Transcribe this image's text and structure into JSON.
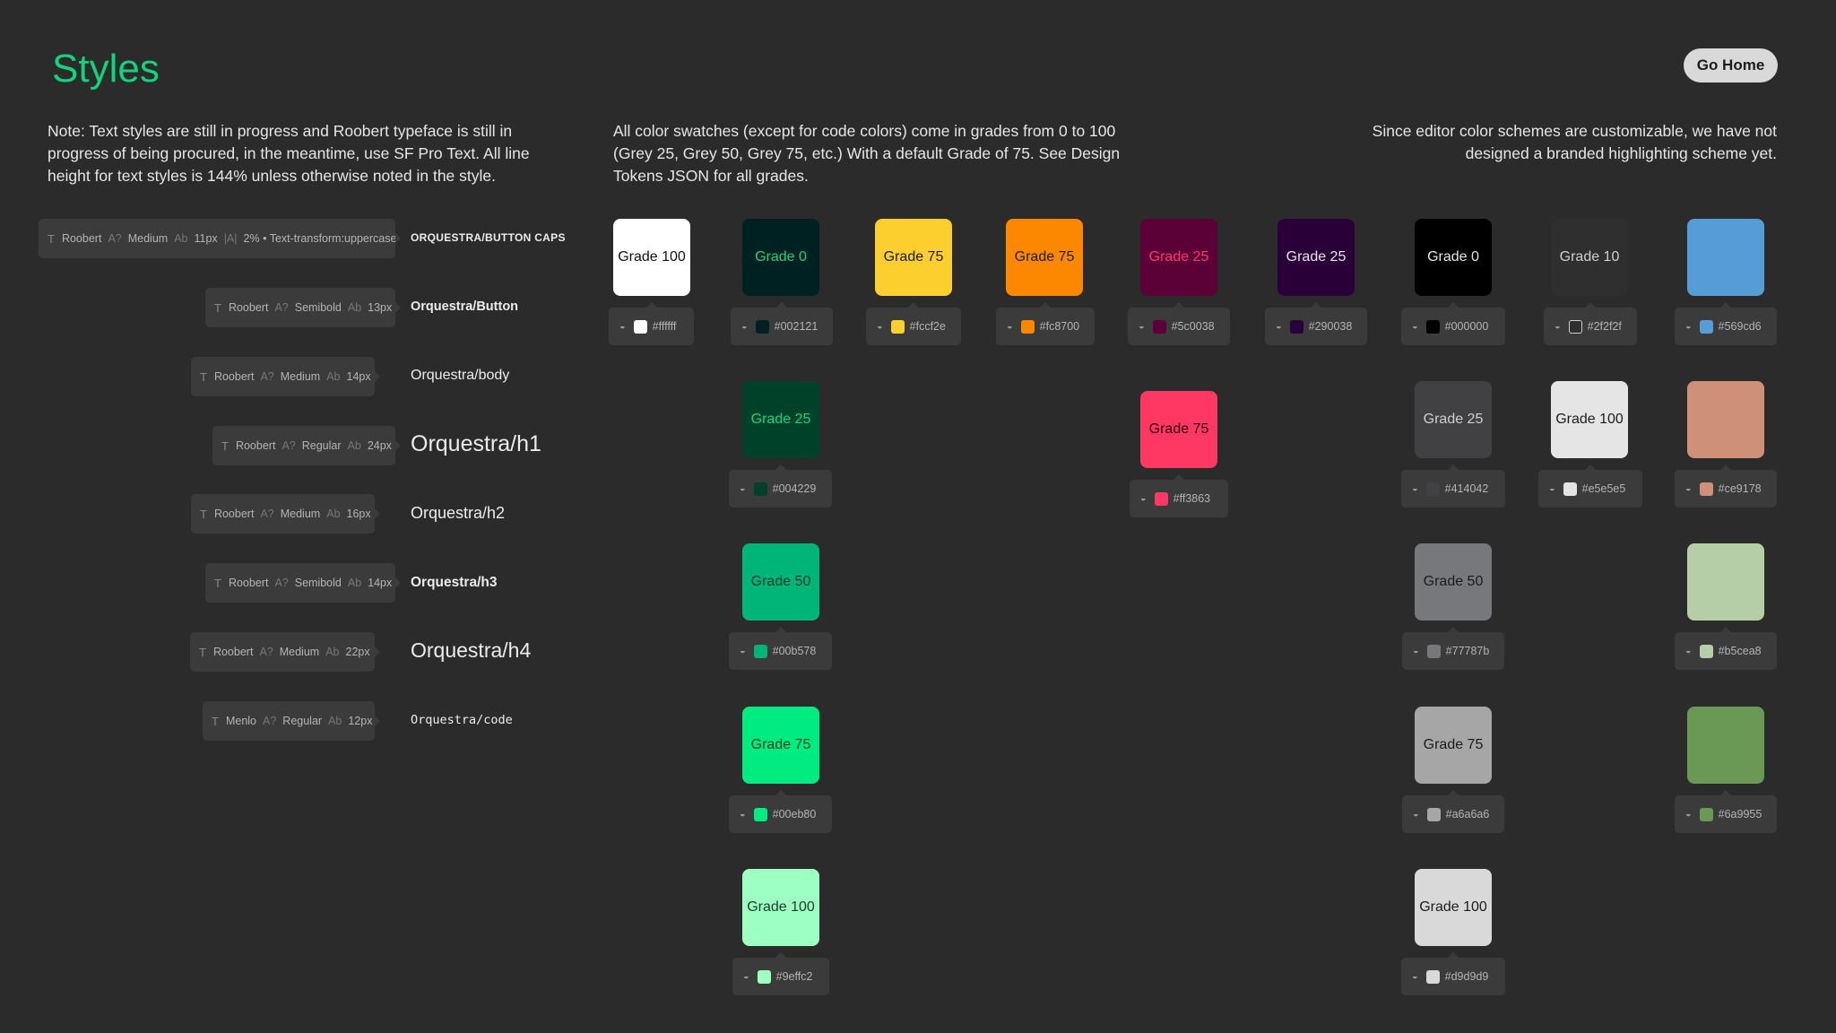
{
  "page": {
    "title": "Styles",
    "go_home_label": "Go Home",
    "note_text": "Note: Text styles are still in progress and Roobert typeface is still in progress of being procured, in the meantime, use SF Pro Text. All line height for text styles is 144% unless otherwise noted in the style.",
    "note_color": "All color swatches (except for code colors) come in grades from 0 to 100 (Grey 25, Grey 50, Grey 75, etc.) With a default Grade of 75. See Design Tokens JSON for all grades.",
    "note_editor": "Since editor color schemes are customizable, we have not designed a branded highlighting scheme yet."
  },
  "text_styles": [
    {
      "font": "Roobert",
      "weight": "Medium",
      "size": "11px",
      "extra_label": "|A|",
      "extra": "2% • Text-transform:uppercase",
      "name": "ORQUESTRA/BUTTON CAPS"
    },
    {
      "font": "Roobert",
      "weight": "Semibold",
      "size": "13px",
      "name": "Orquestra/Button"
    },
    {
      "font": "Roobert",
      "weight": "Medium",
      "size": "14px",
      "name": "Orquestra/body"
    },
    {
      "font": "Roobert",
      "weight": "Regular",
      "size": "24px",
      "name": "Orquestra/h1"
    },
    {
      "font": "Roobert",
      "weight": "Medium",
      "size": "16px",
      "name": "Orquestra/h2"
    },
    {
      "font": "Roobert",
      "weight": "Semibold",
      "size": "14px",
      "name": "Orquestra/h3"
    },
    {
      "font": "Roobert",
      "weight": "Medium",
      "size": "22px",
      "name": "Orquestra/h4"
    },
    {
      "font": "Menlo",
      "weight": "Regular",
      "size": "12px",
      "name": "Orquestra/code"
    }
  ],
  "pill_labels": {
    "weight": "A?",
    "size": "Ab"
  },
  "colors": {
    "accent": "#11d47a",
    "background": "#2b2b2b",
    "tag_background": "#3b3b3b"
  },
  "swatches": [
    {
      "label": "Grade 100",
      "hex": "#ffffff",
      "text_color": "#111111"
    },
    {
      "label": "Grade 0",
      "hex": "#002121",
      "text_color": "#14d47e"
    },
    {
      "label": "Grade 25",
      "hex": "#004229",
      "text_color": "#14d47e"
    },
    {
      "label": "Grade 50",
      "hex": "#00b578",
      "text_color": "#0f3d2a"
    },
    {
      "label": "Grade 75",
      "hex": "#00eb80",
      "text_color": "#0f3d2a"
    },
    {
      "label": "Grade 100",
      "hex": "#9effc2",
      "text_color": "#1a3d2a"
    },
    {
      "label": "Grade 75",
      "hex": "#fccf2e",
      "text_color": "#1c1c1c"
    },
    {
      "label": "Grade 75",
      "hex": "#fc8700",
      "text_color": "#1c1c1c"
    },
    {
      "label": "Grade 25",
      "hex": "#5c0038",
      "text_color": "#ff3868"
    },
    {
      "label": "Grade 75",
      "hex": "#ff3863",
      "text_color": "#2b0010"
    },
    {
      "label": "Grade 25",
      "hex": "#290038",
      "text_color": "#e6e6e6"
    },
    {
      "label": "Grade 0",
      "hex": "#000000",
      "text_color": "#e6e6e6"
    },
    {
      "label": "Grade 25",
      "hex": "#414042",
      "text_color": "#cfcfcf"
    },
    {
      "label": "Grade 50",
      "hex": "#77787b",
      "text_color": "#1c1c1c"
    },
    {
      "label": "Grade 75",
      "hex": "#a6a6a6",
      "text_color": "#1c1c1c"
    },
    {
      "label": "Grade 100",
      "hex": "#d9d9d9",
      "text_color": "#1c1c1c"
    },
    {
      "label": "Grade 10",
      "hex": "#2f2f2f",
      "text_color": "#cfcfcf"
    },
    {
      "label": "Grade 100",
      "hex": "#e5e5e5",
      "text_color": "#1c1c1c"
    },
    {
      "label": "",
      "hex": "#569cd6",
      "text_color": "#ffffff"
    },
    {
      "label": "",
      "hex": "#ce9178",
      "text_color": "#ffffff"
    },
    {
      "label": "",
      "hex": "#b5cea8",
      "text_color": "#ffffff"
    },
    {
      "label": "",
      "hex": "#6a9955",
      "text_color": "#ffffff"
    }
  ]
}
